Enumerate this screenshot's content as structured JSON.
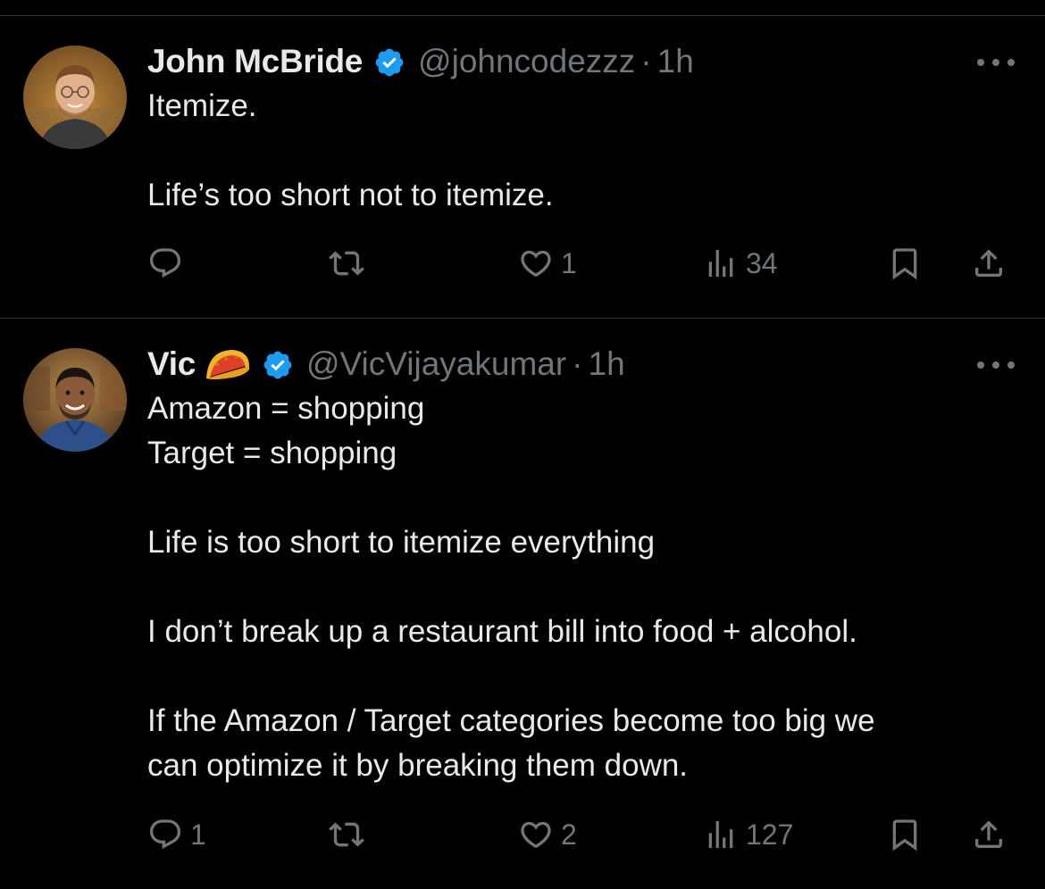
{
  "tweets": [
    {
      "author_name": "John McBride",
      "handle": "@johncodezzz",
      "separator": "·",
      "time": "1h",
      "verified": true,
      "avatar_icon": "person-avatar",
      "body": [
        "Itemize.",
        "",
        "Life’s too short not to itemize."
      ],
      "counts": {
        "replies": "",
        "reposts": "",
        "likes": "1",
        "views": "34"
      }
    },
    {
      "author_name": "Vic",
      "name_emoji": "taco-icon",
      "handle": "@VicVijayakumar",
      "separator": "·",
      "time": "1h",
      "verified": true,
      "avatar_icon": "person-avatar",
      "body": [
        "Amazon = shopping",
        "Target = shopping",
        "",
        "Life is too short to itemize everything",
        "",
        "I don’t break up a restaurant bill into food + alcohol.",
        "",
        "If the Amazon / Target categories become too big we",
        "can optimize it by breaking them down."
      ],
      "counts": {
        "replies": "1",
        "reposts": "",
        "likes": "2",
        "views": "127"
      }
    }
  ],
  "colors": {
    "background": "#000000",
    "primary_text": "#e7e9ea",
    "secondary_text": "#71767b",
    "divider": "#2f3336",
    "verified_badge": "#1d9bf0"
  }
}
